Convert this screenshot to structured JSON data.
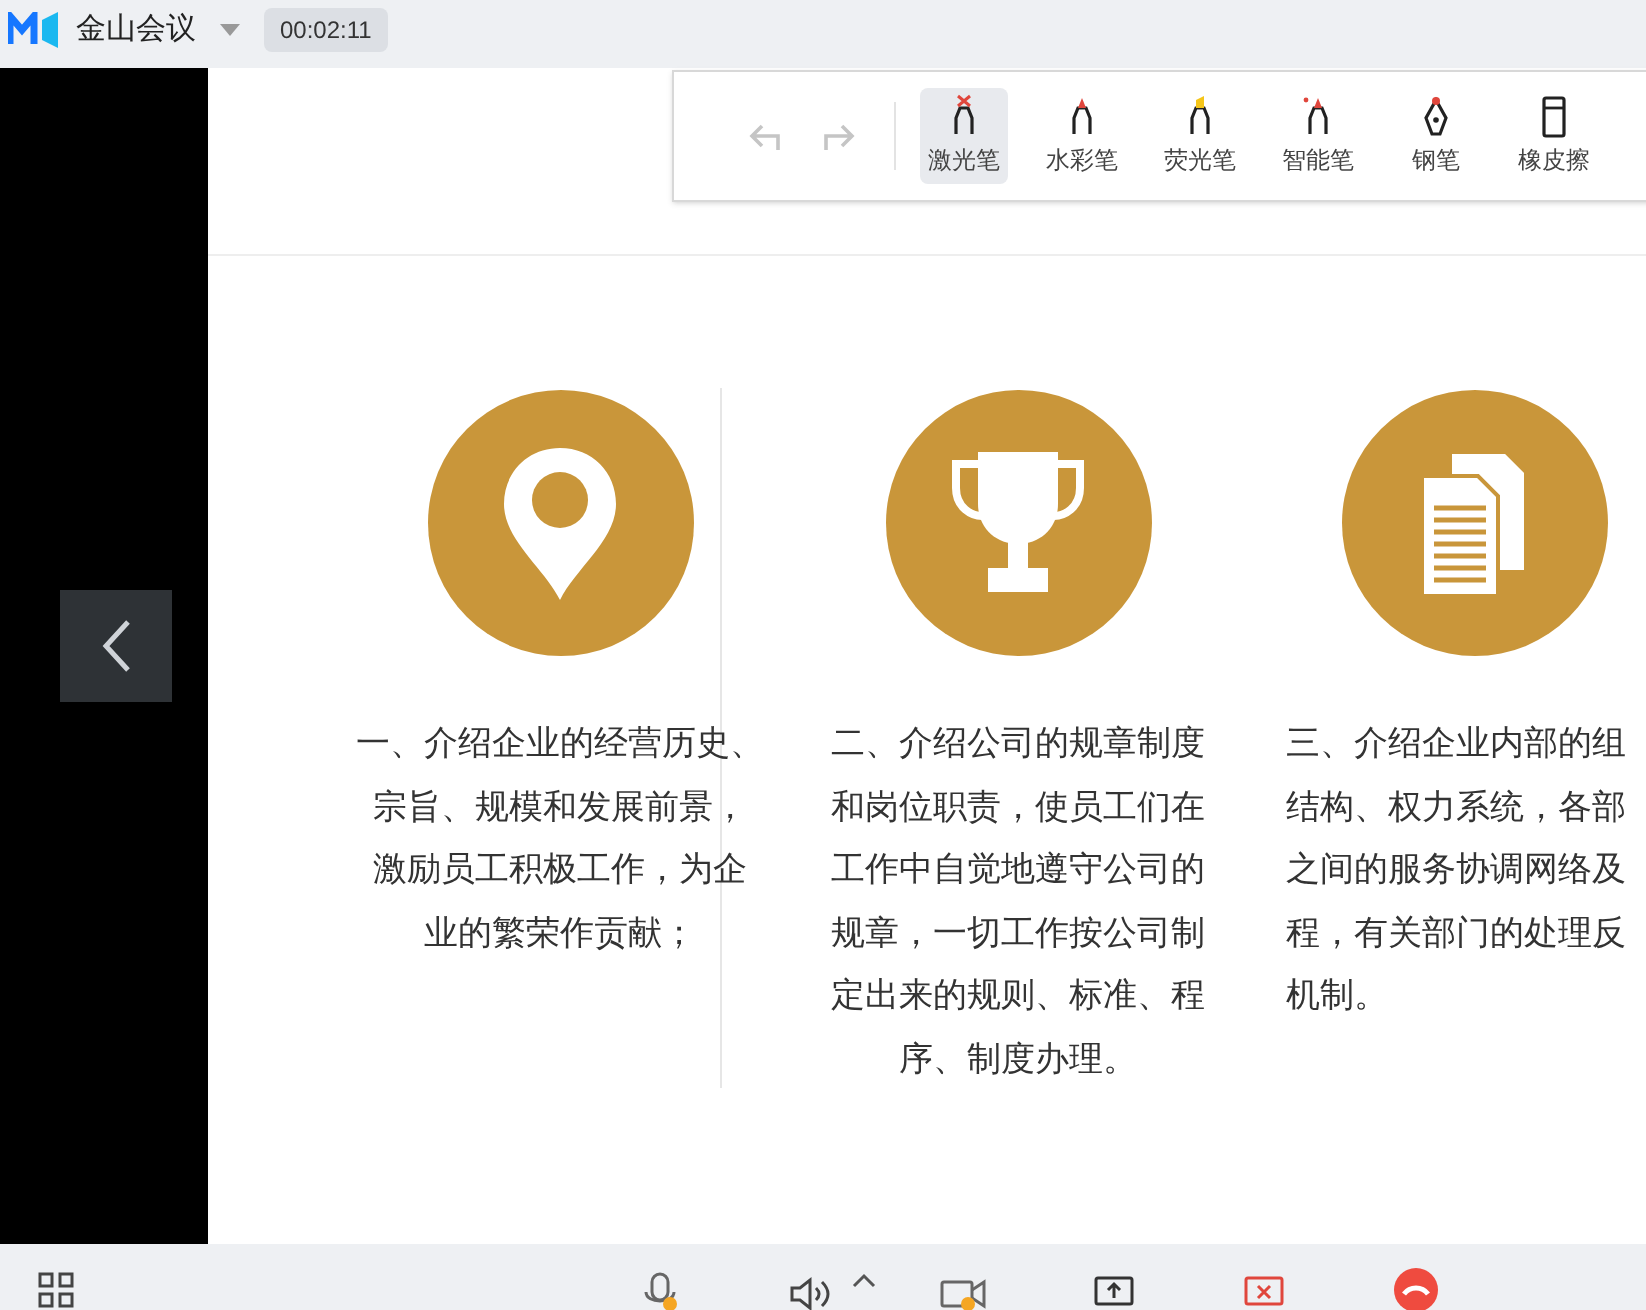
{
  "app": {
    "title": "金山会议",
    "timer": "00:02:11"
  },
  "toolbar": {
    "undo_disabled": true,
    "redo_disabled": true,
    "tools": [
      {
        "kind": "laser",
        "label": "激光笔",
        "selected": true
      },
      {
        "kind": "watercolor",
        "label": "水彩笔",
        "selected": false
      },
      {
        "kind": "highlighter",
        "label": "荧光笔",
        "selected": false
      },
      {
        "kind": "smart",
        "label": "智能笔",
        "selected": false
      },
      {
        "kind": "pen",
        "label": "钢笔",
        "selected": false
      },
      {
        "kind": "eraser",
        "label": "橡皮擦",
        "selected": false
      }
    ]
  },
  "slide": {
    "columns": [
      {
        "kind": "pin",
        "lines": [
          "一、介绍企业的经营历史、",
          "宗旨、规模和发展前景，",
          "激励员工积极工作，为企",
          "业的繁荣作贡献；"
        ]
      },
      {
        "kind": "trophy",
        "lines": [
          "二、介绍公司的规章制度",
          "和岗位职责，使员工们在",
          "工作中自觉地遵守公司的",
          "规章，一切工作按公司制",
          "定出来的规则、标准、程",
          "序、制度办理。"
        ]
      },
      {
        "kind": "document",
        "lines": [
          "三、介绍企业内部的组",
          "结构、权力系统，各部",
          "之间的服务协调网络及",
          "程，有关部门的处理反",
          "机制。"
        ]
      }
    ]
  },
  "bottom_bar": {
    "mic_muted": true,
    "camera_off": true
  }
}
